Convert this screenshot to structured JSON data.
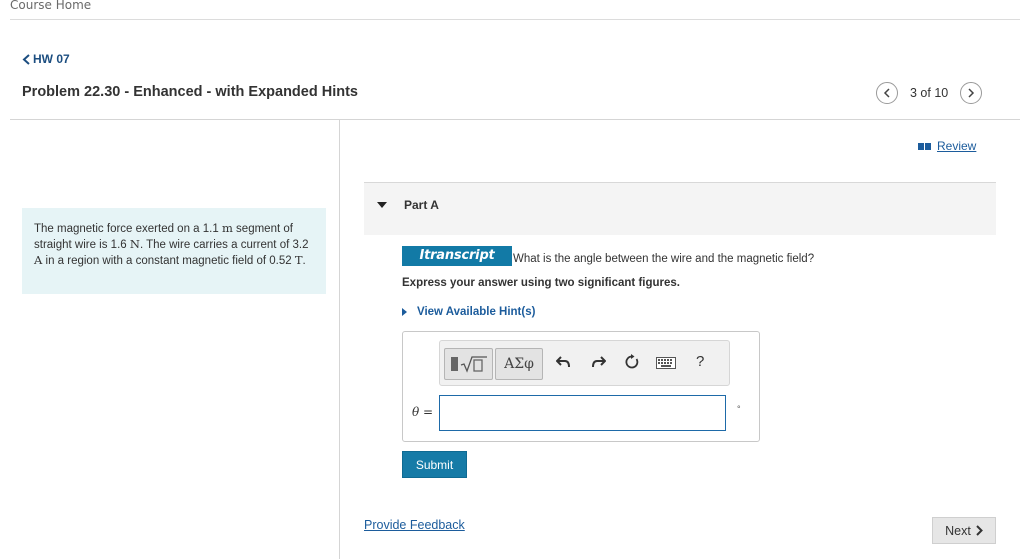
{
  "nav": {
    "course_home": "Course Home",
    "back_link": "HW 07"
  },
  "header": {
    "title": "Problem 22.30 - Enhanced - with Expanded Hints",
    "pager": "3 of 10"
  },
  "review": {
    "label": "Review"
  },
  "problem": {
    "text_1": "The magnetic force exerted on a 1.1 ",
    "unit_m": "m",
    "text_2": " segment of straight wire is 1.6 ",
    "unit_n": "N",
    "text_3": ". The wire carries a current of 3.2 ",
    "unit_a": "A",
    "text_4": " in a region with a constant magnetic field of 0.52 ",
    "unit_t": "T",
    "text_5": "."
  },
  "part": {
    "label": "Part A",
    "badge": "Itranscript",
    "question": "What is the angle between the wire and the magnetic field?",
    "instructions": "Express your answer using two significant figures.",
    "hint_link": "View Available Hint(s)"
  },
  "toolbar": {
    "template_label": "▌√▯",
    "greek_label": "ΑΣφ",
    "help_label": "?"
  },
  "answer": {
    "variable": "θ",
    "equals": " =",
    "value": "",
    "unit": "°"
  },
  "buttons": {
    "submit": "Submit",
    "feedback": "Provide Feedback",
    "next": "Next"
  },
  "colors": {
    "accent": "#167ba7",
    "link": "#1c5c9c",
    "problem_bg": "#e6f4f6"
  }
}
